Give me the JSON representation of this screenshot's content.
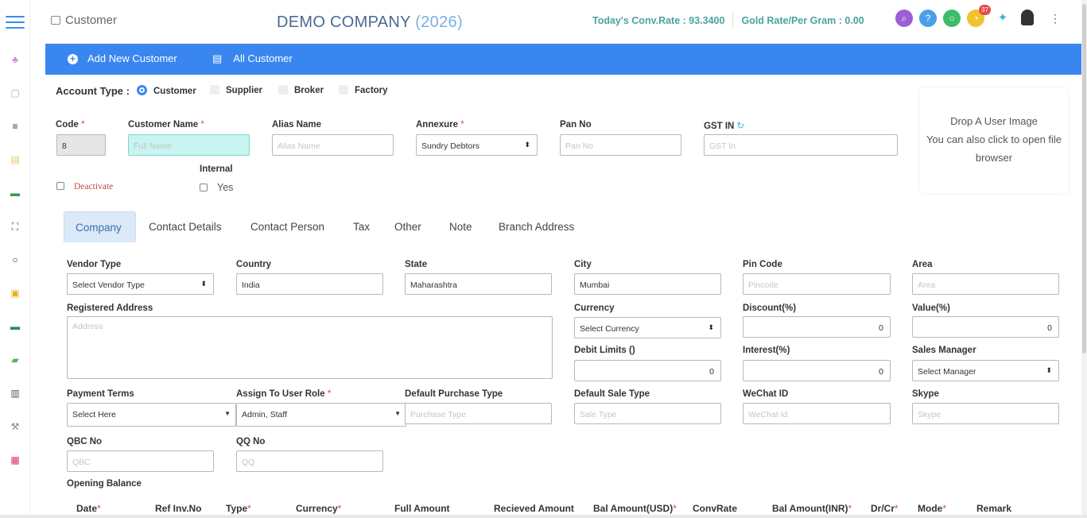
{
  "header": {
    "breadcrumb": "Customer",
    "company_name": "DEMO COMPANY",
    "company_year": "(2026)",
    "conv_rate_label": "Today's Conv.Rate : 93.3400",
    "gold_rate_label": "Gold Rate/Per Gram : 0.00",
    "notification_count": "37"
  },
  "actionbar": {
    "add_new": "Add New Customer",
    "all": "All Customer"
  },
  "account_type": {
    "label": "Account Type :",
    "options": [
      "Customer",
      "Supplier",
      "Broker",
      "Factory"
    ],
    "selected": "Customer"
  },
  "basic": {
    "code_label": "Code",
    "code_value": "8",
    "name_label": "Customer Name",
    "name_placeholder": "Full Name",
    "alias_label": "Alias Name",
    "alias_placeholder": "Alias Name",
    "annexure_label": "Annexure",
    "annexure_value": "Sundry Debtors",
    "pan_label": "Pan No",
    "pan_placeholder": "Pan No",
    "gst_label": "GST IN",
    "gst_placeholder": "GST In",
    "deactivate_label": "Deactivate",
    "internal_label": "Internal",
    "internal_yes": "Yes"
  },
  "dropzone": {
    "line1": "Drop A User Image",
    "line2": "You can also click to open file",
    "line3": "browser"
  },
  "tabs": [
    "Company",
    "Contact Details",
    "Contact Person",
    "Tax",
    "Other",
    "Note",
    "Branch Address"
  ],
  "company": {
    "vendor_type_label": "Vendor Type",
    "vendor_type_value": "Select Vendor Type",
    "country_label": "Country",
    "country_value": "India",
    "state_label": "State",
    "state_value": "Maharashtra",
    "city_label": "City",
    "city_value": "Mumbai",
    "pin_label": "Pin Code",
    "pin_placeholder": "Pincode",
    "area_label": "Area",
    "area_placeholder": "Area",
    "reg_address_label": "Registered Address",
    "reg_address_placeholder": "Address",
    "currency_label": "Currency",
    "currency_value": "Select Currency",
    "discount_label": "Discount(%)",
    "discount_value": "0",
    "value_label": "Value(%)",
    "value_value": "0",
    "debit_label": "Debit Limits ()",
    "debit_value": "0",
    "interest_label": "Interest(%)",
    "interest_value": "0",
    "sales_mgr_label": "Sales Manager",
    "sales_mgr_value": "Select Manager",
    "payment_label": "Payment Terms",
    "payment_value": "Select Here",
    "role_label": "Assign To User Role",
    "role_value": "Admin, Staff",
    "def_purchase_label": "Default Purchase Type",
    "def_purchase_placeholder": "Purchase Type",
    "def_sale_label": "Default Sale Type",
    "def_sale_placeholder": "Sale Type",
    "wechat_label": "WeChat ID",
    "wechat_placeholder": "WeChat Id",
    "skype_label": "Skype",
    "skype_placeholder": "Skype",
    "qbc_label": "QBC No",
    "qbc_placeholder": "QBC",
    "qq_label": "QQ No",
    "qq_placeholder": "QQ",
    "opening_balance_label": "Opening Balance"
  },
  "opening_table": {
    "columns": [
      {
        "label": "Date",
        "req": "*"
      },
      {
        "label": "Ref Inv.No",
        "req": ""
      },
      {
        "label": "Type",
        "req": "*"
      },
      {
        "label": "Currency",
        "req": "*"
      },
      {
        "label": "Full Amount",
        "req": ""
      },
      {
        "label": "Recieved Amount",
        "req": ""
      },
      {
        "label": "Bal Amount(USD)",
        "req": "*"
      },
      {
        "label": "ConvRate",
        "req": ""
      },
      {
        "label": "Bal Amount(INR)",
        "req": "*"
      },
      {
        "label": "Dr/Cr",
        "req": "*"
      },
      {
        "label": "Mode",
        "req": "*"
      },
      {
        "label": "Remark",
        "req": ""
      }
    ]
  },
  "colors": {
    "primary": "#3a86f0",
    "required": "#e04848",
    "rate_text": "#4aa3a0"
  }
}
